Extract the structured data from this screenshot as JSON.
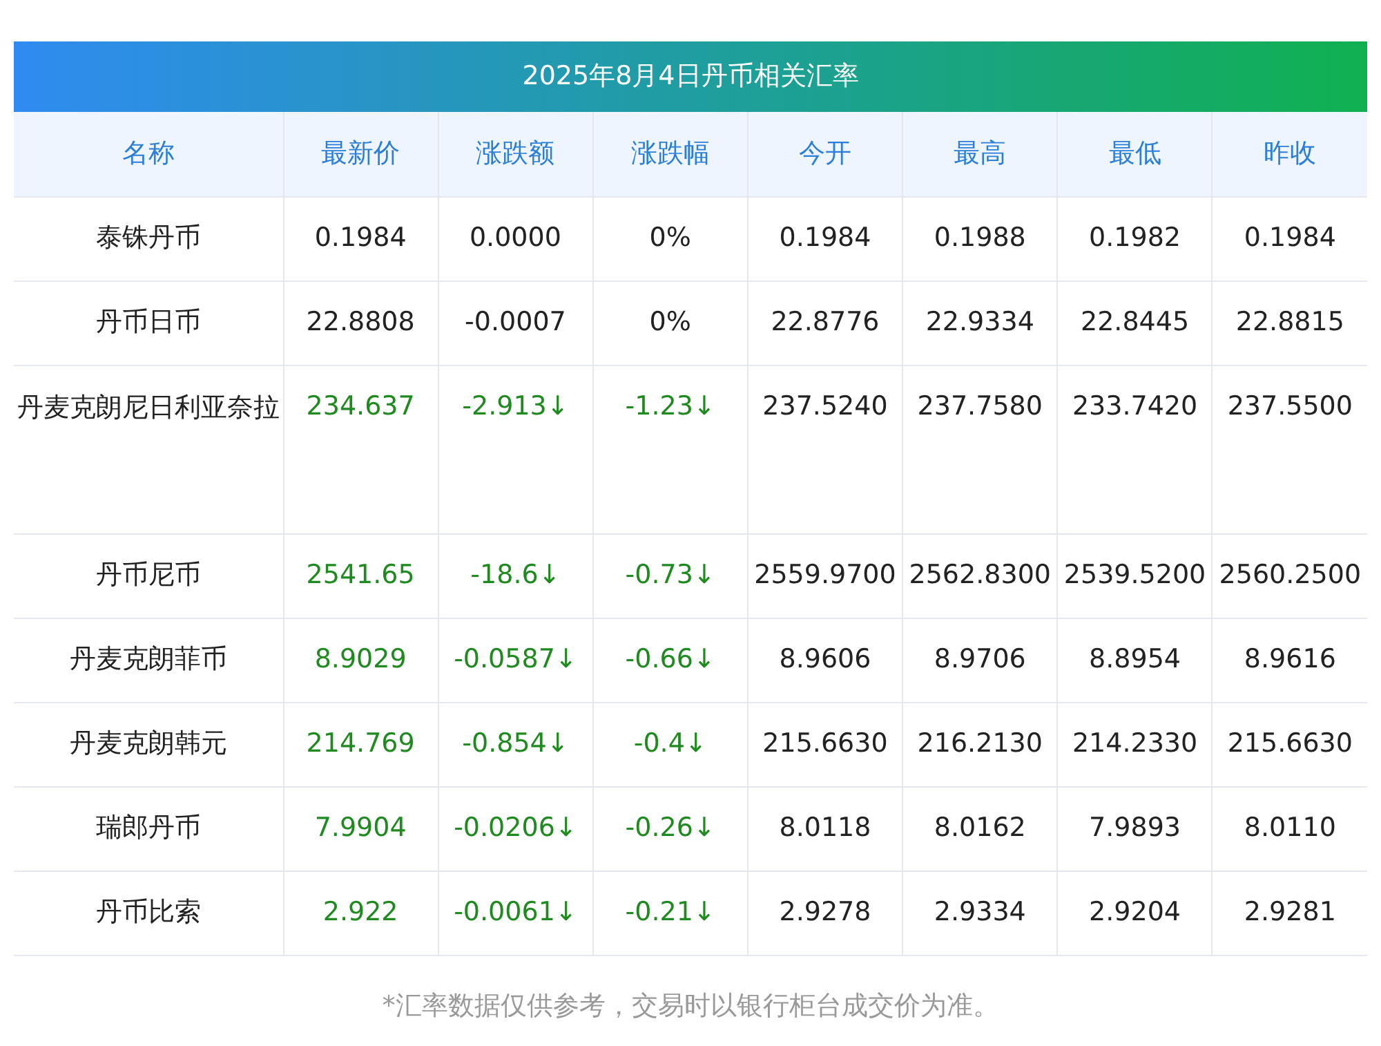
{
  "title": "2025年8月4日丹币相关汇率",
  "columns": [
    "名称",
    "最新价",
    "涨跌额",
    "涨跌幅",
    "今开",
    "最高",
    "最低",
    "昨收"
  ],
  "rows": [
    {
      "name": "泰铢丹币",
      "falling": false,
      "cells": [
        "0.1984",
        "0.0000",
        "0%",
        "0.1984",
        "0.1988",
        "0.1982",
        "0.1984"
      ]
    },
    {
      "name": "丹币日币",
      "falling": false,
      "cells": [
        "22.8808",
        "-0.0007",
        "0%",
        "22.8776",
        "22.9334",
        "22.8445",
        "22.8815"
      ]
    },
    {
      "name": "丹麦克朗尼日利亚奈拉",
      "falling": true,
      "cells": [
        "234.637",
        "-2.913↓",
        "-1.23↓",
        "237.5240",
        "237.7580",
        "233.7420",
        "237.5500"
      ]
    },
    {
      "name": "丹币尼币",
      "falling": true,
      "cells": [
        "2541.65",
        "-18.6↓",
        "-0.73↓",
        "2559.9700",
        "2562.8300",
        "2539.5200",
        "2560.2500"
      ]
    },
    {
      "name": "丹麦克朗菲币",
      "falling": true,
      "cells": [
        "8.9029",
        "-0.0587↓",
        "-0.66↓",
        "8.9606",
        "8.9706",
        "8.8954",
        "8.9616"
      ]
    },
    {
      "name": "丹麦克朗韩元",
      "falling": true,
      "cells": [
        "214.769",
        "-0.854↓",
        "-0.4↓",
        "215.6630",
        "216.2130",
        "214.2330",
        "215.6630"
      ]
    },
    {
      "name": "瑞郎丹币",
      "falling": true,
      "cells": [
        "7.9904",
        "-0.0206↓",
        "-0.26↓",
        "8.0118",
        "8.0162",
        "7.9893",
        "8.0110"
      ]
    },
    {
      "name": "丹币比索",
      "falling": true,
      "cells": [
        "2.922",
        "-0.0061↓",
        "-0.21↓",
        "2.9278",
        "2.9334",
        "2.9204",
        "2.9281"
      ]
    }
  ],
  "footnote": "*汇率数据仅供参考，交易时以银行柜台成交价为准。"
}
